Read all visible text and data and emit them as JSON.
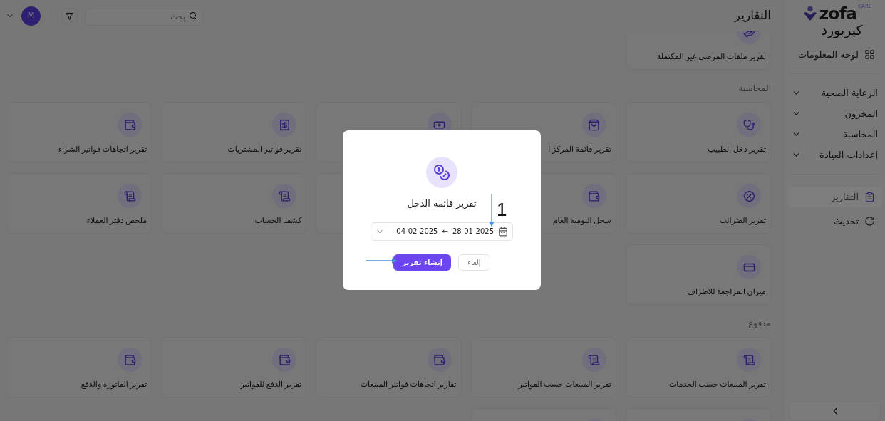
{
  "sidebar": {
    "logo": {
      "word": "zofa",
      "tag": "CARE"
    },
    "brand": "كيربورد",
    "items": [
      {
        "kind": "dashboard",
        "label": "لوحة المعلومات",
        "selected": false
      },
      {
        "kind": "divider"
      },
      {
        "kind": "group",
        "label": "الرعاية الصحية",
        "expanded": false
      },
      {
        "kind": "group",
        "label": "المخزون",
        "expanded": false
      },
      {
        "kind": "group",
        "label": "المحاسبة",
        "expanded": false
      },
      {
        "kind": "group",
        "label": "إعدادات العيادة",
        "expanded": false
      },
      {
        "kind": "divider"
      },
      {
        "kind": "reports",
        "label": "التقارير",
        "selected": true
      },
      {
        "kind": "refresh",
        "label": "تحديث",
        "selected": false
      }
    ]
  },
  "header": {
    "title": "التقارير",
    "search": {
      "placeholder": "بحث"
    },
    "avatar": "M"
  },
  "sections": [
    {
      "cards": [
        {
          "kind": "hand",
          "title": "تقرير ملفات المرضى غير المكتملة"
        }
      ]
    },
    {
      "title": "المحاسبة",
      "cards": [
        {
          "kind": "stethoscope",
          "title": "تقرير دخل الطبيب"
        },
        {
          "kind": "bag",
          "title": "تقرير قائمة المركز ا"
        },
        {
          "kind": "banknote"
        },
        {
          "kind": "bill",
          "title": "تقرير فواتير المشتريات"
        },
        {
          "kind": "wallet",
          "title": "تقرير اتجاهات فواتير الشراء"
        },
        {
          "kind": "tax",
          "title": "تقرير الضرائب"
        },
        {
          "kind": "wallet",
          "title": "سجل اليومية العام"
        },
        {
          "kind": "covered"
        },
        {
          "kind": "receipt",
          "title": "كشف الحساب"
        },
        {
          "kind": "receipt",
          "title": "ملخص دفتر العملاء"
        },
        {
          "kind": "card",
          "title": "ميزان المراجعة للاطراف"
        }
      ]
    },
    {
      "title": "مدفوع",
      "cards": [
        {
          "kind": "receipt",
          "title": "تقرير المبيعات حسب الخدمات"
        },
        {
          "kind": "receipt",
          "title": "تقرير المبيعات حسب الفواتير"
        },
        {
          "kind": "wallet",
          "title": "تقارير اتجاهات فواتير المبيعات"
        },
        {
          "kind": "wallet",
          "title": "تقرير الدفع للفواتير"
        },
        {
          "kind": "wallet",
          "title": "تقرير الفاتورة والدفع"
        },
        {
          "kind": "receipt"
        },
        {
          "kind": "receipt"
        }
      ]
    }
  ],
  "modal": {
    "title": "تقرير قائمة الدخل",
    "date_from": "28-01-2025",
    "date_separator": "←",
    "date_to": "04-02-2025",
    "confirm": "إنشاء تقرير",
    "cancel": "إلغاء"
  },
  "annotations": [
    {
      "kind": "arrow-down",
      "label": "1"
    },
    {
      "kind": "arrow-right"
    }
  ]
}
